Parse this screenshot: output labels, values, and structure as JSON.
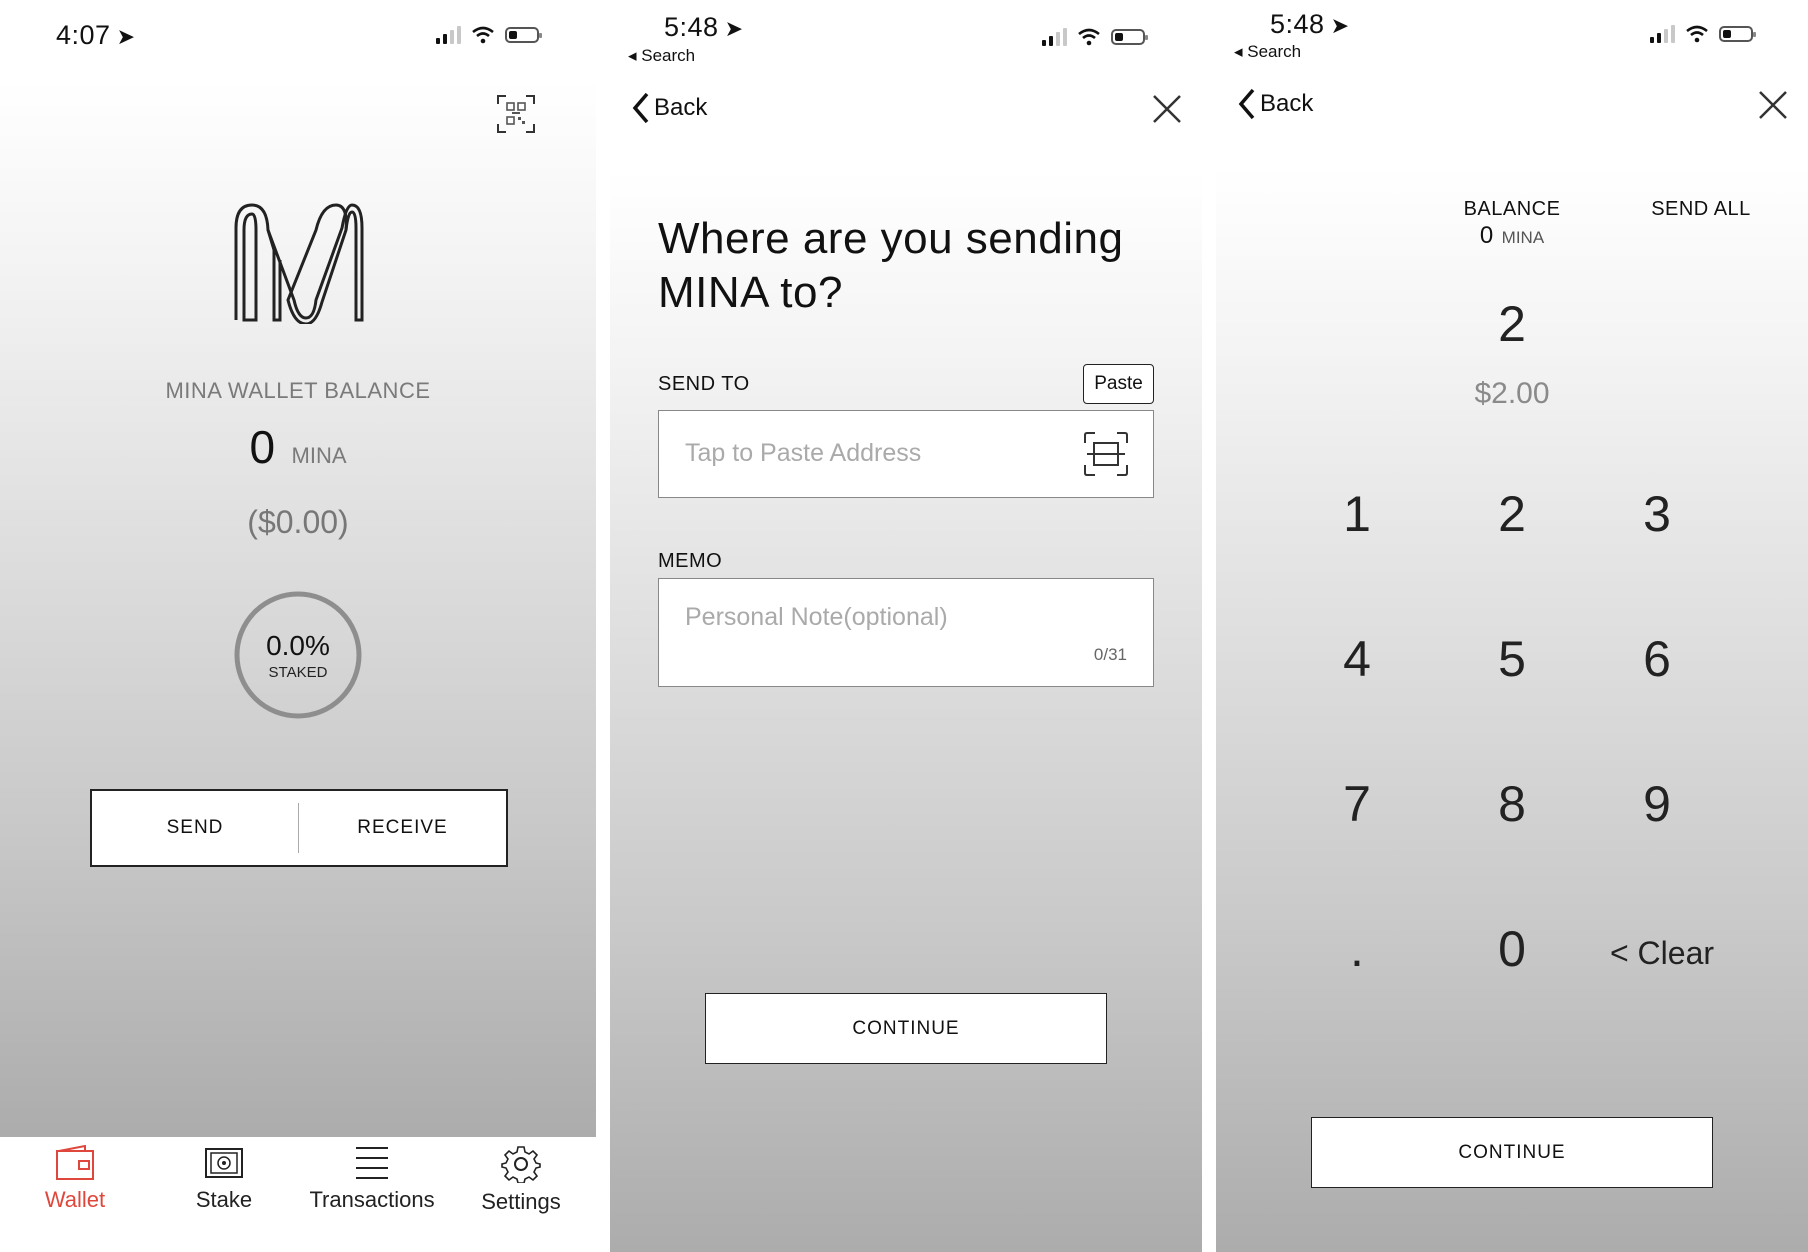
{
  "colors": {
    "accent": "#e0473c",
    "text": "#111111",
    "muted": "#7a7a7a"
  },
  "screen1": {
    "status": {
      "time": "4:07"
    },
    "icons": {
      "qr": "qr-code-icon",
      "logo": "mina-logo",
      "location": "location-arrow-icon"
    },
    "balance_label": "MINA WALLET BALANCE",
    "balance_amount": "0",
    "balance_unit": "MINA",
    "balance_fiat": "($0.00)",
    "staked_percent": "0.0%",
    "staked_label": "STAKED",
    "staked_fraction": 0.0,
    "send_label": "SEND",
    "receive_label": "RECEIVE",
    "tabs": [
      {
        "label": "Wallet",
        "icon": "wallet-icon",
        "active": true
      },
      {
        "label": "Stake",
        "icon": "safe-icon",
        "active": false
      },
      {
        "label": "Transactions",
        "icon": "list-icon",
        "active": false
      },
      {
        "label": "Settings",
        "icon": "gear-icon",
        "active": false
      }
    ]
  },
  "screen2": {
    "status": {
      "time": "5:48",
      "search": "◂ Search"
    },
    "back_label": "Back",
    "title_line1": "Where are you sending",
    "title_line2": "MINA to?",
    "send_to_label": "SEND TO",
    "paste_label": "Paste",
    "address_placeholder": "Tap to Paste Address",
    "memo_label": "MEMO",
    "memo_placeholder": "Personal Note(optional)",
    "memo_counter": "0/31",
    "continue_label": "CONTINUE"
  },
  "screen3": {
    "status": {
      "time": "5:48",
      "search": "◂ Search"
    },
    "back_label": "Back",
    "balance_label": "BALANCE",
    "balance_amount": "0",
    "balance_unit": "MINA",
    "send_all_label": "SEND ALL",
    "amount": "2",
    "amount_fiat": "$2.00",
    "keys": [
      "1",
      "2",
      "3",
      "4",
      "5",
      "6",
      "7",
      "8",
      "9",
      ".",
      "0",
      "< Clear"
    ],
    "continue_label": "CONTINUE"
  }
}
